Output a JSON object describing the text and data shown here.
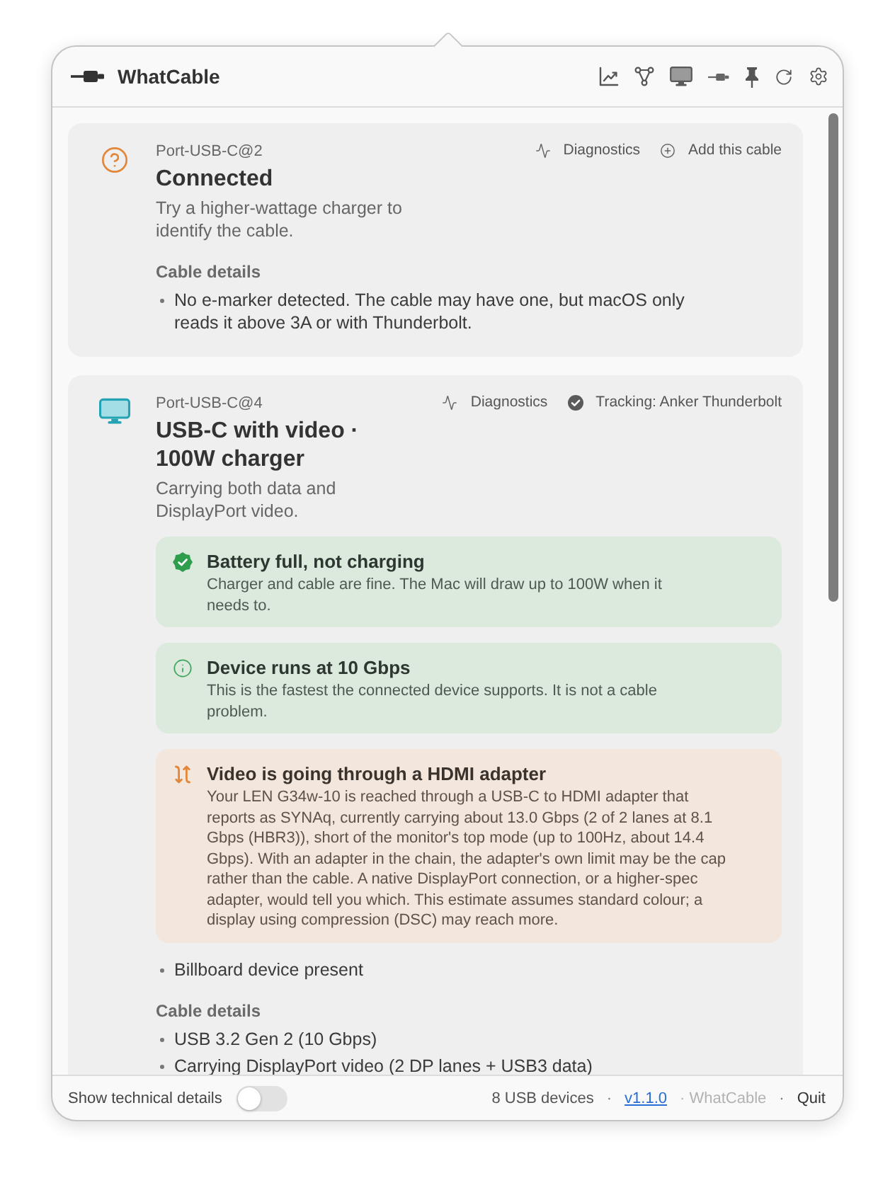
{
  "window": {
    "title": "WhatCable"
  },
  "ports": [
    {
      "kind": "unknown",
      "port": "Port-USB-C@2",
      "actions": [
        {
          "kind": "diagnostics",
          "label": "Diagnostics"
        },
        {
          "kind": "add",
          "label": "Add this cable"
        }
      ],
      "title": "Connected",
      "subtitle": "Try a higher-wattage charger to identify the cable.",
      "sections": [
        {
          "heading": "Cable details",
          "items": [
            "No e-marker detected. The cable may have one, but macOS only reads it above 3A or with Thunderbolt."
          ]
        }
      ]
    },
    {
      "kind": "display",
      "port": "Port-USB-C@4",
      "actions": [
        {
          "kind": "diagnostics",
          "label": "Diagnostics"
        },
        {
          "kind": "tracking",
          "label": "Tracking: Anker Thunderbolt"
        }
      ],
      "title": "USB-C with video · 100W charger",
      "subtitle": "Carrying both data and DisplayPort video.",
      "alerts": [
        {
          "kind": "success",
          "title": "Battery full, not charging",
          "body": "Charger and cable are fine. The Mac will draw up to 100W when it needs to."
        },
        {
          "kind": "info",
          "title": "Device runs at 10 Gbps",
          "body": "This is the fastest the connected device supports. It is not a cable problem."
        },
        {
          "kind": "warning",
          "title": "Video is going through a HDMI adapter",
          "body": "Your LEN G34w-10 is reached through a USB-C to HDMI adapter that reports as SYNAq, currently carrying about 13.0 Gbps (2 of 2 lanes at 8.1 Gbps (HBR3)), short of the monitor's top mode (up to 100Hz, about 14.4 Gbps). With an adapter in the chain, the adapter's own limit may be the cap rather than the cable. A native DisplayPort connection, or a higher-spec adapter, would tell you which. This estimate assumes standard colour; a display using compression (DSC) may reach more."
        }
      ],
      "notes": [
        "Billboard device present"
      ],
      "sections": [
        {
          "heading": "Cable details",
          "items": [
            "USB 3.2 Gen 2 (10 Gbps)",
            "Carrying DisplayPort video (2 DP lanes + USB3 data)"
          ]
        }
      ]
    }
  ],
  "footer": {
    "toggle": {
      "label": "Show technical details",
      "on": false
    },
    "items": [
      {
        "kind": "text",
        "text": "8 USB devices"
      },
      {
        "kind": "separator",
        "text": "·"
      },
      {
        "kind": "link",
        "text": "v1.1.0"
      },
      {
        "kind": "muted",
        "text": "· WhatCable"
      },
      {
        "kind": "separator",
        "text": "·"
      },
      {
        "kind": "button",
        "text": "Quit"
      }
    ]
  }
}
